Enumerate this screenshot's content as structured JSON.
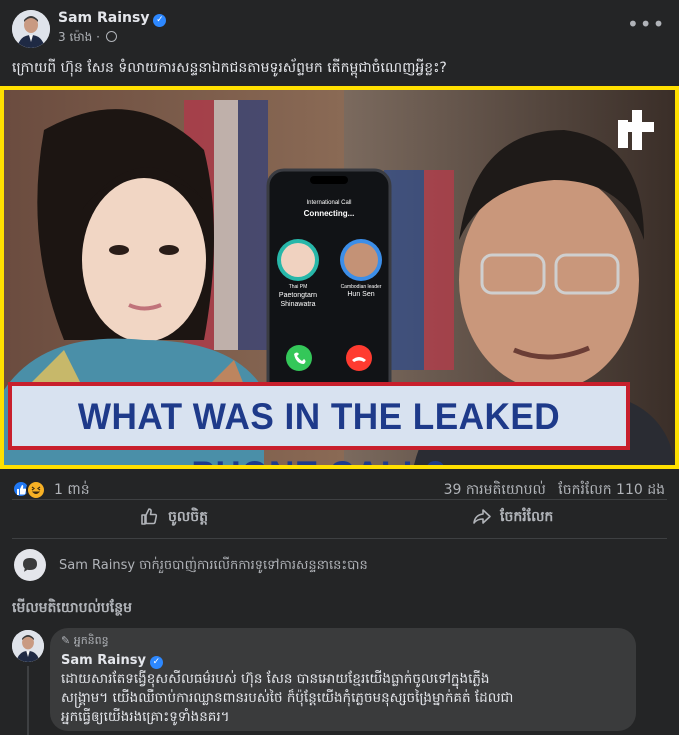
{
  "post": {
    "author": "Sam Rainsy",
    "time": "3 ម៉ោង",
    "time_separator": "·",
    "caption": "ក្រោយពី ហ៊ុន សែន ទំលាយការសន្ទនាឯកជនតាមទូរស័ព្ទមក តើកម្ពុជាចំណេញអ្វីខ្លះ?",
    "more_glyph": "•••"
  },
  "image": {
    "logo": "+",
    "call_header": "International Call",
    "call_status": "Connecting...",
    "left_role": "Thai PM",
    "left_name_1": "Paetongtarn",
    "left_name_2": "Shinawatra",
    "right_role": "Cambodian leader",
    "right_name": "Hun Sen",
    "banner": "WHAT WAS IN THE LEAKED PHONE CALL?"
  },
  "reactions": {
    "count": "1 ពាន់",
    "comments": "39 ការមតិយោបល់",
    "shares": "ចែករំលែក 110 ដង"
  },
  "actions": {
    "like": "ចូលចិត្ត",
    "share": "ចែករំលែក"
  },
  "restriction": {
    "text": "Sam Rainsy ចាក់រួចបាញ់ការលើកការទូទៅការសន្ទនានេះបាន"
  },
  "comments": {
    "view_more": "មើលមតិយោបល់បន្ថែម",
    "items": [
      {
        "badge": "អ្នកនិពន្ធ",
        "author": "Sam Rainsy",
        "text_line1": "ដោយសារតែទង្វើខុសសីលធម៌របស់ ហ៊ុន សែន បានអោយខ្មែរយើងធ្លាក់ចូលទៅក្នុងភ្លើង",
        "text_line2": "សង្គ្រាម។ យើងឈឺចាប់ការឈ្លានពានរបស់ថៃ ក៏ប៉ុន្តែយើងកុំភ្លេចមនុស្សចង្រៃម្នាក់គត់ ដែលជា",
        "text_line3": "អ្នកធ្វើឲ្យយើងរងគ្រោះទូទាំងនគរ។"
      }
    ]
  },
  "colors": {
    "background": "#242526",
    "accent": "#2d88ff",
    "image_border": "#ffe000"
  }
}
